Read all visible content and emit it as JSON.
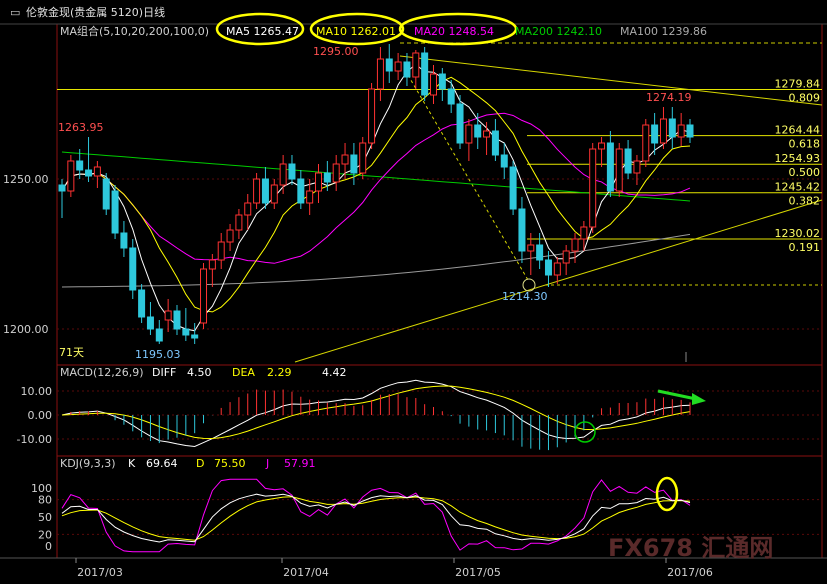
{
  "title": {
    "text": "伦敦金现(贵金属 5120)日线",
    "icon": "window-icon"
  },
  "ma_header": {
    "group": "MA组合(5,10,20,200,100,0)",
    "items": [
      {
        "label": "MA5 1265.47",
        "color": "#ffffff"
      },
      {
        "label": "MA10 1262.01",
        "color": "#ffff00"
      },
      {
        "label": "MA20 1248.54",
        "color": "#ff00ff"
      },
      {
        "label": "MA200 1242.10",
        "color": "#00cc00"
      },
      {
        "label": "MA100 1239.86",
        "color": "#aaaaaa"
      }
    ]
  },
  "macd_header": {
    "name": "MACD(12,26,9)",
    "diff_label": "DIFF",
    "diff": "4.50",
    "dea_label": "DEA",
    "dea": "2.29",
    "macd": "4.42"
  },
  "kdj_header": {
    "name": "KDJ(9,3,3)",
    "k_label": "K",
    "k": "69.64",
    "d_label": "D",
    "d": "75.50",
    "j_label": "J",
    "j": "57.91"
  },
  "watermark": "FX678 汇通网",
  "chart_data": {
    "type": "candlestick",
    "price_ticks": [
      "1250.00",
      "1200.00"
    ],
    "macd_ticks": [
      "10.00",
      "0.00",
      "-10.00"
    ],
    "kdj_ticks": [
      "100",
      "80",
      "50",
      "20",
      "0"
    ],
    "x_labels": [
      "2017/03",
      "2017/04",
      "2017/05",
      "2017/06"
    ],
    "fib_levels": [
      {
        "price": 1279.84,
        "ratio": "0.809"
      },
      {
        "price": 1264.44,
        "ratio": "0.618"
      },
      {
        "price": 1254.93,
        "ratio": "0.500"
      },
      {
        "price": 1245.42,
        "ratio": "0.382"
      },
      {
        "price": 1230.02,
        "ratio": "0.191"
      }
    ],
    "annotations": [
      {
        "text": "1263.95",
        "kind": "high"
      },
      {
        "text": "1195.03",
        "kind": "low"
      },
      {
        "text": "1295.00",
        "kind": "high"
      },
      {
        "text": "1214.30",
        "kind": "low"
      },
      {
        "text": "1274.19",
        "kind": "high"
      },
      {
        "text": "71天",
        "kind": "count"
      }
    ],
    "candles": [
      [
        1248,
        1250,
        1237,
        1246
      ],
      [
        1246,
        1258,
        1244,
        1256
      ],
      [
        1256,
        1260,
        1250,
        1253
      ],
      [
        1253,
        1264,
        1249,
        1251
      ],
      [
        1251,
        1256,
        1247,
        1254
      ],
      [
        1250,
        1252,
        1238,
        1240
      ],
      [
        1246,
        1248,
        1230,
        1232
      ],
      [
        1232,
        1236,
        1224,
        1227
      ],
      [
        1227,
        1230,
        1210,
        1213
      ],
      [
        1213,
        1215,
        1202,
        1204
      ],
      [
        1204,
        1209,
        1198,
        1200
      ],
      [
        1200,
        1203,
        1195,
        1196
      ],
      [
        1203,
        1210,
        1199,
        1206
      ],
      [
        1206,
        1208,
        1198,
        1200
      ],
      [
        1200,
        1207,
        1196,
        1198
      ],
      [
        1198,
        1202,
        1195,
        1197
      ],
      [
        1202,
        1222,
        1200,
        1220
      ],
      [
        1220,
        1225,
        1214,
        1223
      ],
      [
        1223,
        1232,
        1220,
        1229
      ],
      [
        1229,
        1235,
        1226,
        1233
      ],
      [
        1233,
        1240,
        1230,
        1238
      ],
      [
        1238,
        1245,
        1233,
        1242
      ],
      [
        1242,
        1252,
        1240,
        1250
      ],
      [
        1250,
        1254,
        1240,
        1242
      ],
      [
        1242,
        1250,
        1240,
        1248
      ],
      [
        1248,
        1258,
        1245,
        1255
      ],
      [
        1255,
        1258,
        1248,
        1250
      ],
      [
        1250,
        1253,
        1240,
        1242
      ],
      [
        1242,
        1250,
        1238,
        1246
      ],
      [
        1246,
        1255,
        1242,
        1252
      ],
      [
        1252,
        1256,
        1246,
        1249
      ],
      [
        1249,
        1258,
        1246,
        1255
      ],
      [
        1255,
        1262,
        1250,
        1258
      ],
      [
        1258,
        1262,
        1248,
        1252
      ],
      [
        1252,
        1264,
        1250,
        1262
      ],
      [
        1262,
        1282,
        1260,
        1280
      ],
      [
        1280,
        1294,
        1276,
        1290
      ],
      [
        1290,
        1295,
        1282,
        1286
      ],
      [
        1286,
        1292,
        1283,
        1289
      ],
      [
        1289,
        1292,
        1281,
        1284
      ],
      [
        1284,
        1293,
        1280,
        1292
      ],
      [
        1292,
        1294,
        1276,
        1278
      ],
      [
        1278,
        1288,
        1275,
        1285
      ],
      [
        1285,
        1287,
        1276,
        1280
      ],
      [
        1280,
        1283,
        1272,
        1275
      ],
      [
        1275,
        1278,
        1260,
        1262
      ],
      [
        1262,
        1270,
        1256,
        1268
      ],
      [
        1268,
        1272,
        1260,
        1264
      ],
      [
        1264,
        1269,
        1258,
        1266
      ],
      [
        1266,
        1270,
        1256,
        1258
      ],
      [
        1258,
        1262,
        1250,
        1254
      ],
      [
        1254,
        1256,
        1238,
        1240
      ],
      [
        1240,
        1244,
        1222,
        1226
      ],
      [
        1226,
        1232,
        1218,
        1228
      ],
      [
        1228,
        1232,
        1220,
        1223
      ],
      [
        1223,
        1226,
        1214,
        1218
      ],
      [
        1218,
        1224,
        1215,
        1222
      ],
      [
        1222,
        1228,
        1218,
        1226
      ],
      [
        1226,
        1232,
        1222,
        1230
      ],
      [
        1230,
        1236,
        1226,
        1234
      ],
      [
        1234,
        1262,
        1232,
        1260
      ],
      [
        1260,
        1264,
        1254,
        1262
      ],
      [
        1262,
        1266,
        1244,
        1246
      ],
      [
        1246,
        1262,
        1244,
        1260
      ],
      [
        1260,
        1263,
        1250,
        1252
      ],
      [
        1252,
        1258,
        1248,
        1256
      ],
      [
        1256,
        1270,
        1254,
        1268
      ],
      [
        1268,
        1272,
        1258,
        1262
      ],
      [
        1262,
        1274,
        1260,
        1270
      ],
      [
        1270,
        1274,
        1260,
        1264
      ],
      [
        1264,
        1272,
        1261,
        1268
      ],
      [
        1268,
        1270,
        1262,
        1264
      ]
    ]
  }
}
